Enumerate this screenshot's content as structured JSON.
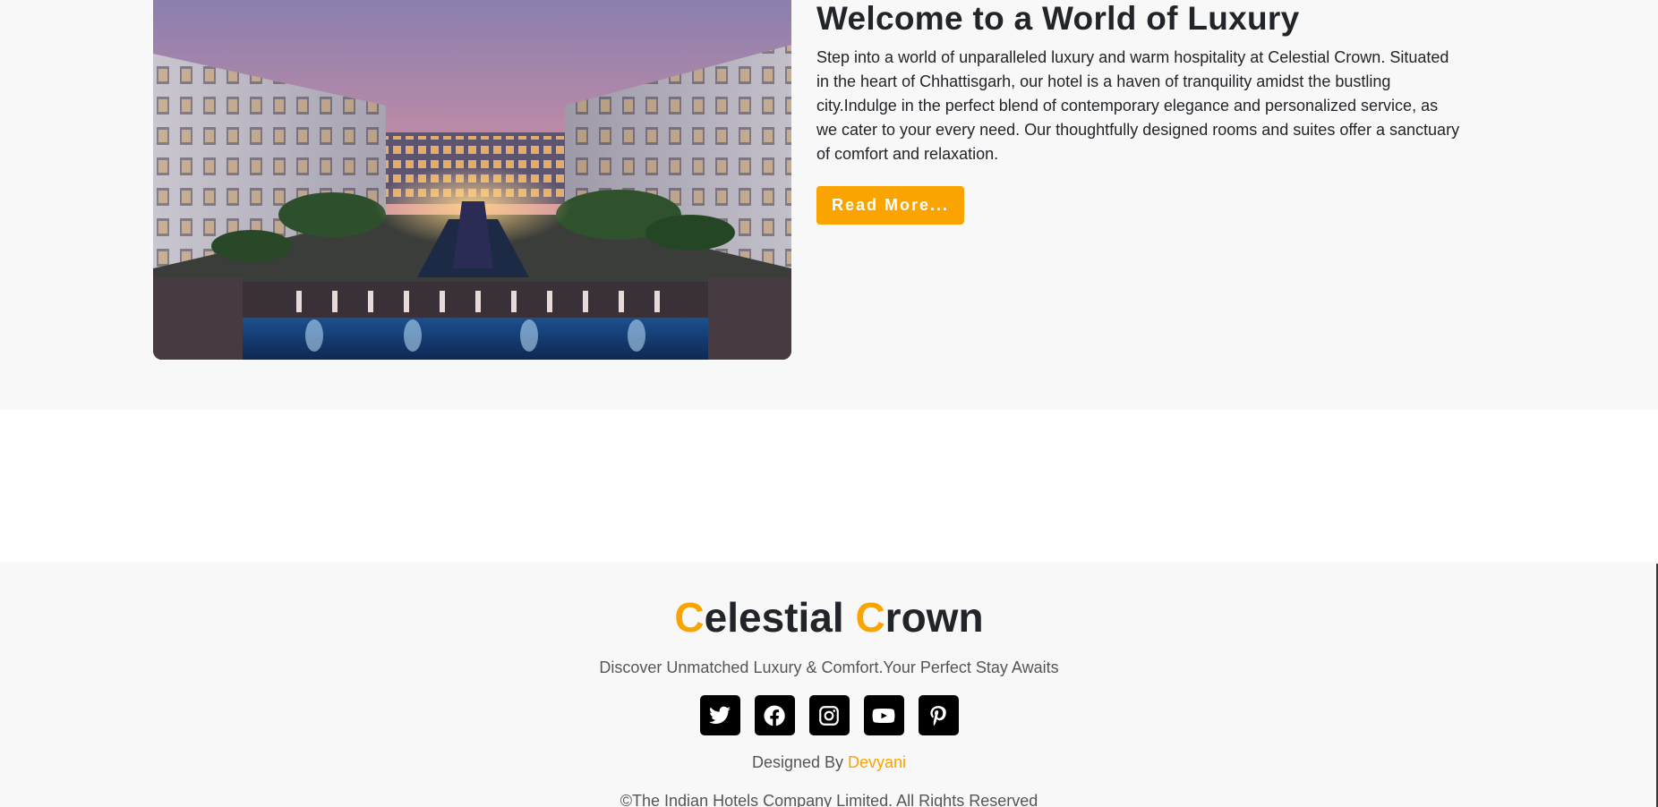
{
  "about": {
    "title": "Welcome to a World of Luxury",
    "body": "Step into a world of unparalleled luxury and warm hospitality at Celestial Crown. Situated in the heart of Chhattisgarh, our hotel is a haven of tranquility amidst the bustling city.Indulge in the perfect blend of contemporary elegance and personalized service, as we cater to your every need. Our thoughtfully designed rooms and suites offer a sanctuary of comfort and relaxation.",
    "read_more_label": "Read More...",
    "image_subject": "hotel-courtyard-at-dusk"
  },
  "footer": {
    "brand": {
      "word1_initial": "C",
      "word1_rest": "elestial ",
      "word2_initial": "C",
      "word2_rest": "rown"
    },
    "tagline": "Discover Unmatched Luxury & Comfort.Your Perfect Stay Awaits",
    "social": [
      {
        "name": "twitter",
        "icon": "twitter-icon"
      },
      {
        "name": "facebook",
        "icon": "facebook-icon"
      },
      {
        "name": "instagram",
        "icon": "instagram-icon"
      },
      {
        "name": "youtube",
        "icon": "youtube-icon"
      },
      {
        "name": "pinterest",
        "icon": "pinterest-icon"
      }
    ],
    "designed_prefix": "Designed By ",
    "designed_author": "Devyani",
    "copyright": "©The Indian Hotels Company Limited. All Rights Reserved"
  },
  "colors": {
    "accent": "#f9a400",
    "text": "#212529",
    "muted": "#555555",
    "section_bg": "#f8f8f8",
    "icon_bg": "#000000"
  }
}
